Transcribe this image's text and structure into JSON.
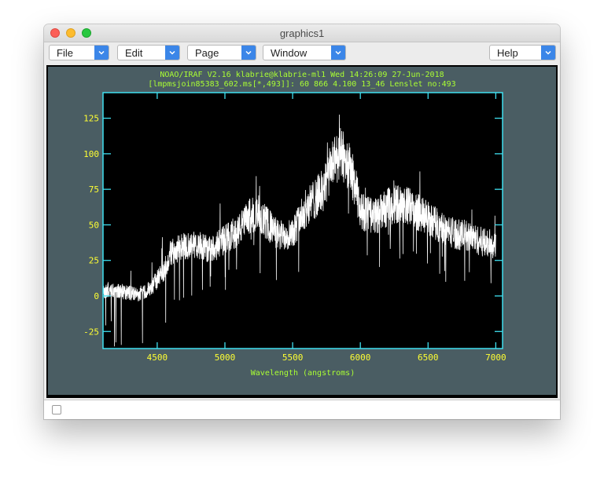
{
  "window": {
    "title": "graphics1"
  },
  "menubar": {
    "file": "File",
    "edit": "Edit",
    "page": "Page",
    "window": "Window",
    "help": "Help"
  },
  "plot": {
    "header_line1": "NOAO/IRAF V2.16 klabrie@klabrie-ml1 Wed 14:26:09 27-Jun-2018",
    "header_line2": "[lmpmsjoin85383_602.ms[*,493]]: 60 866   4.100 13_46 Lenslet no:493"
  },
  "colors": {
    "plot_background": "#4a5d63",
    "axes": "#3fe0f0",
    "tick_labels": "#ffff33",
    "header_text": "#aaff33",
    "spectrum": "#ffffff"
  },
  "chart_data": {
    "type": "line",
    "xlabel": "Wavelength (angstroms)",
    "ylabel": "",
    "xlim": [
      4100,
      7050
    ],
    "ylim": [
      -37,
      143
    ],
    "x_ticks": [
      4500,
      5000,
      5500,
      6000,
      6500,
      7000
    ],
    "y_ticks": [
      -25,
      0,
      25,
      50,
      75,
      100,
      125
    ],
    "series": [
      {
        "x": [
          4100,
          4150,
          4250,
          4350,
          4450,
          4550,
          4600,
          4650,
          4700,
          4800,
          4900,
          5000,
          5100,
          5200,
          5300,
          5400,
          5500,
          5600,
          5700,
          5750,
          5800,
          5850,
          5900,
          5950,
          6000,
          6100,
          6200,
          6300,
          6400,
          6500,
          6600,
          6700,
          6800,
          6900,
          7000
        ],
        "y": [
          2,
          5,
          3,
          1,
          5,
          18,
          30,
          33,
          35,
          36,
          32,
          40,
          46,
          58,
          52,
          42,
          45,
          62,
          72,
          80,
          95,
          100,
          95,
          82,
          60,
          55,
          62,
          66,
          60,
          55,
          48,
          44,
          42,
          38,
          36
        ]
      }
    ]
  }
}
